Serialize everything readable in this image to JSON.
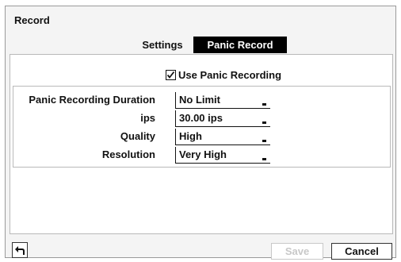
{
  "window": {
    "title": "Record"
  },
  "tabs": [
    {
      "label": "Settings",
      "active": false
    },
    {
      "label": "Panic Record",
      "active": true
    }
  ],
  "use_panic_recording": {
    "label": "Use Panic Recording",
    "checked": true
  },
  "fields": [
    {
      "label": "Panic Recording Duration",
      "value": "No Limit"
    },
    {
      "label": "ips",
      "value": "30.00 ips"
    },
    {
      "label": "Quality",
      "value": "High"
    },
    {
      "label": "Resolution",
      "value": "Very High"
    }
  ],
  "buttons": {
    "back_icon": "back-arrow-icon",
    "save": {
      "label": "Save",
      "enabled": false
    },
    "cancel": {
      "label": "Cancel",
      "enabled": true
    }
  },
  "colors": {
    "active_tab_bg": "#000000",
    "active_tab_text": "#ffffff",
    "disabled_text": "#c8c8c8",
    "panel_bg": "#f4f4f4"
  }
}
